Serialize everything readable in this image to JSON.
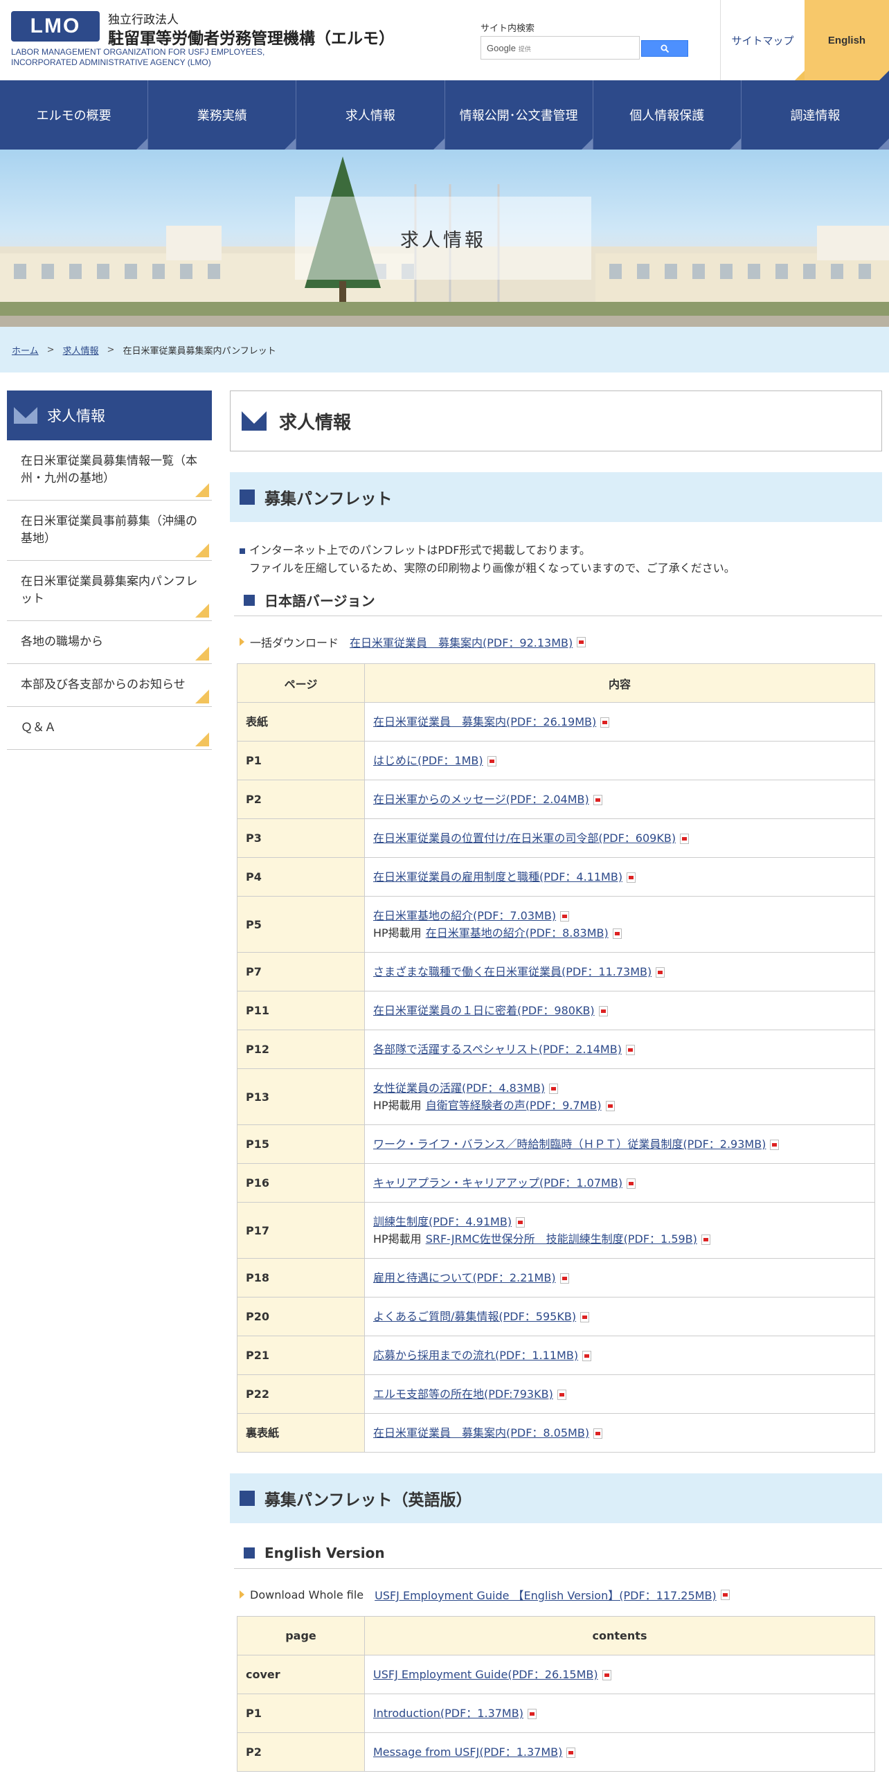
{
  "header": {
    "logo_text": "LMO",
    "org_sub": "独立行政法人",
    "org_name": "駐留軍等労働者労務管理機構（エルモ）",
    "org_en_line1": "LABOR MANAGEMENT ORGANIZATION FOR USFJ EMPLOYEES,",
    "org_en_line2": "INCORPORATED ADMINISTRATIVE AGENCY (LMO)",
    "search_label": "サイト内検索",
    "search_brand": "Google",
    "search_brand_sub": "提供",
    "sitemap": "サイトマップ",
    "english": "English"
  },
  "gnav": [
    "エルモの概要",
    "業務実績",
    "求人情報",
    "情報公開･公文書管理",
    "個人情報保護",
    "調達情報"
  ],
  "hero": {
    "title": "求人情報"
  },
  "breadcrumb": {
    "home": "ホーム",
    "jobs": "求人情報",
    "current": "在日米軍従業員募集案内パンフレット",
    "sep": ">"
  },
  "sidebar": {
    "title": "求人情報",
    "items": [
      "在日米軍従業員募集情報一覧（本州・九州の基地）",
      "在日米軍従業員事前募集（沖縄の基地）",
      "在日米軍従業員募集案内パンフレット",
      "各地の職場から",
      "本部及び各支部からのお知らせ",
      "Ｑ＆Ａ"
    ]
  },
  "main": {
    "title": "求人情報",
    "section_jp": {
      "heading": "募集パンフレット",
      "note_line1": "インターネット上でのパンフレットはPDF形式で掲載しております。",
      "note_line2": "ファイルを圧縮しているため、実際の印刷物より画像が粗くなっていますので、ご了承ください。",
      "subheading": "日本語バージョン",
      "download_label": "一括ダウンロード",
      "download_link": "在日米軍従業員　募集案内(PDF：92.13MB)",
      "col_page": "ページ",
      "col_content": "内容",
      "rows": [
        {
          "page": "表紙",
          "links": [
            "在日米軍従業員　募集案内(PDF：26.19MB)"
          ]
        },
        {
          "page": "P1",
          "links": [
            "はじめに(PDF：1MB)"
          ]
        },
        {
          "page": "P2",
          "links": [
            "在日米軍からのメッセージ(PDF：2.04MB)"
          ]
        },
        {
          "page": "P3",
          "links": [
            "在日米軍従業員の位置付け/在日米軍の司令部(PDF：609KB)"
          ]
        },
        {
          "page": "P4",
          "links": [
            "在日米軍従業員の雇用制度と職種(PDF：4.11MB)"
          ]
        },
        {
          "page": "P5",
          "links": [
            "在日米軍基地の紹介(PDF：7.03MB)"
          ],
          "extra_prefix": "HP掲載用",
          "extra_link": "在日米軍基地の紹介(PDF：8.83MB)"
        },
        {
          "page": "P7",
          "links": [
            "さまざまな職種で働く在日米軍従業員(PDF：11.73MB)"
          ]
        },
        {
          "page": "P11",
          "links": [
            "在日米軍従業員の１日に密着(PDF：980KB)"
          ]
        },
        {
          "page": "P12",
          "links": [
            "各部隊で活躍するスペシャリスト(PDF：2.14MB)"
          ]
        },
        {
          "page": "P13",
          "links": [
            "女性従業員の活躍(PDF：4.83MB)"
          ],
          "extra_prefix": "HP掲載用",
          "extra_link": "自衛官等経験者の声(PDF：9.7MB)"
        },
        {
          "page": "P15",
          "links": [
            "ワーク・ライフ・バランス／時給制臨時（ＨＰＴ）従業員制度(PDF：2.93MB)"
          ]
        },
        {
          "page": "P16",
          "links": [
            "キャリアプラン・キャリアアップ(PDF：1.07MB)"
          ]
        },
        {
          "page": "P17",
          "links": [
            "訓練生制度(PDF：4.91MB)"
          ],
          "extra_prefix": "HP掲載用",
          "extra_link": "SRF-JRMC佐世保分所　技能訓練生制度(PDF：1.59B)"
        },
        {
          "page": "P18",
          "links": [
            "雇用と待遇について(PDF：2.21MB)"
          ]
        },
        {
          "page": "P20",
          "links": [
            "よくあるご質問/募集情報(PDF：595KB)"
          ]
        },
        {
          "page": "P21",
          "links": [
            "応募から採用までの流れ(PDF：1.11MB)"
          ]
        },
        {
          "page": "P22",
          "links": [
            "エルモ支部等の所在地(PDF:793KB)"
          ]
        },
        {
          "page": "裏表紙",
          "links": [
            "在日米軍従業員　募集案内(PDF：8.05MB)"
          ]
        }
      ]
    },
    "section_en": {
      "heading": "募集パンフレット（英語版）",
      "subheading": "English Version",
      "download_label": "Download Whole file",
      "download_link": "USFJ Employment Guide 【English Version】(PDF：117.25MB)",
      "col_page": "page",
      "col_content": "contents",
      "rows": [
        {
          "page": "cover",
          "links": [
            "USFJ Employment Guide(PDF：26.15MB)"
          ]
        },
        {
          "page": "P1",
          "links": [
            "Introduction(PDF：1.37MB)"
          ]
        },
        {
          "page": "P2",
          "links": [
            "Message from USFJ(PDF：1.37MB)"
          ]
        }
      ]
    }
  }
}
